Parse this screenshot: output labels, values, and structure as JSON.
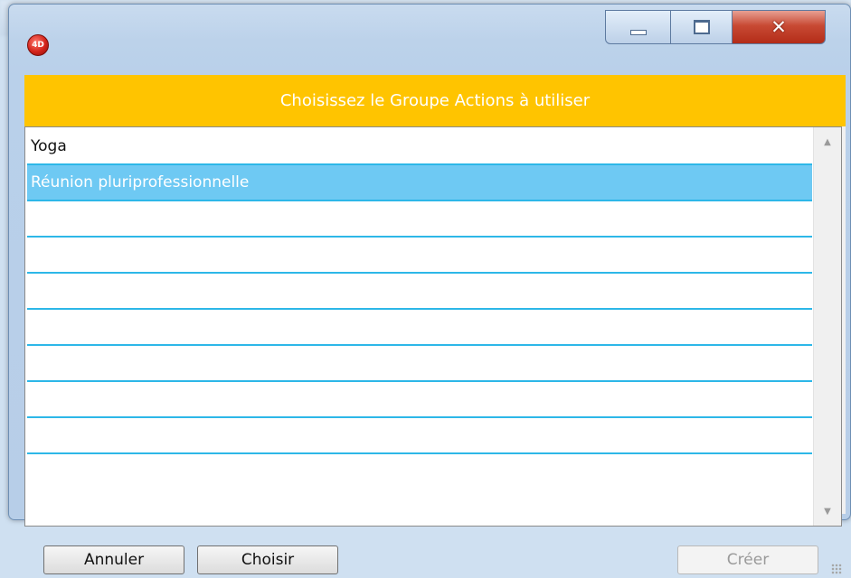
{
  "dialog": {
    "header_text": "Choisissez le Groupe Actions à utiliser",
    "app_icon_text": "4D"
  },
  "window_controls": {
    "minimize_icon": "minimize-icon",
    "maximize_icon": "maximize-icon",
    "close_icon": "close-icon",
    "close_glyph": "✕"
  },
  "list": {
    "items": [
      {
        "label": "Yoga",
        "selected": false
      },
      {
        "label": "Réunion pluriprofessionnelle",
        "selected": true
      },
      {
        "label": "",
        "selected": false
      },
      {
        "label": "",
        "selected": false
      },
      {
        "label": "",
        "selected": false
      },
      {
        "label": "",
        "selected": false
      },
      {
        "label": "",
        "selected": false
      },
      {
        "label": "",
        "selected": false
      },
      {
        "label": "",
        "selected": false
      }
    ],
    "scroll_up_glyph": "▲",
    "scroll_down_glyph": "▼"
  },
  "buttons": {
    "cancel_label": "Annuler",
    "choose_label": "Choisir",
    "create_label": "Créer"
  },
  "colors": {
    "header_bg": "#ffc400",
    "row_separator": "#2db7e8",
    "selected_row": "#6ec9f3"
  }
}
